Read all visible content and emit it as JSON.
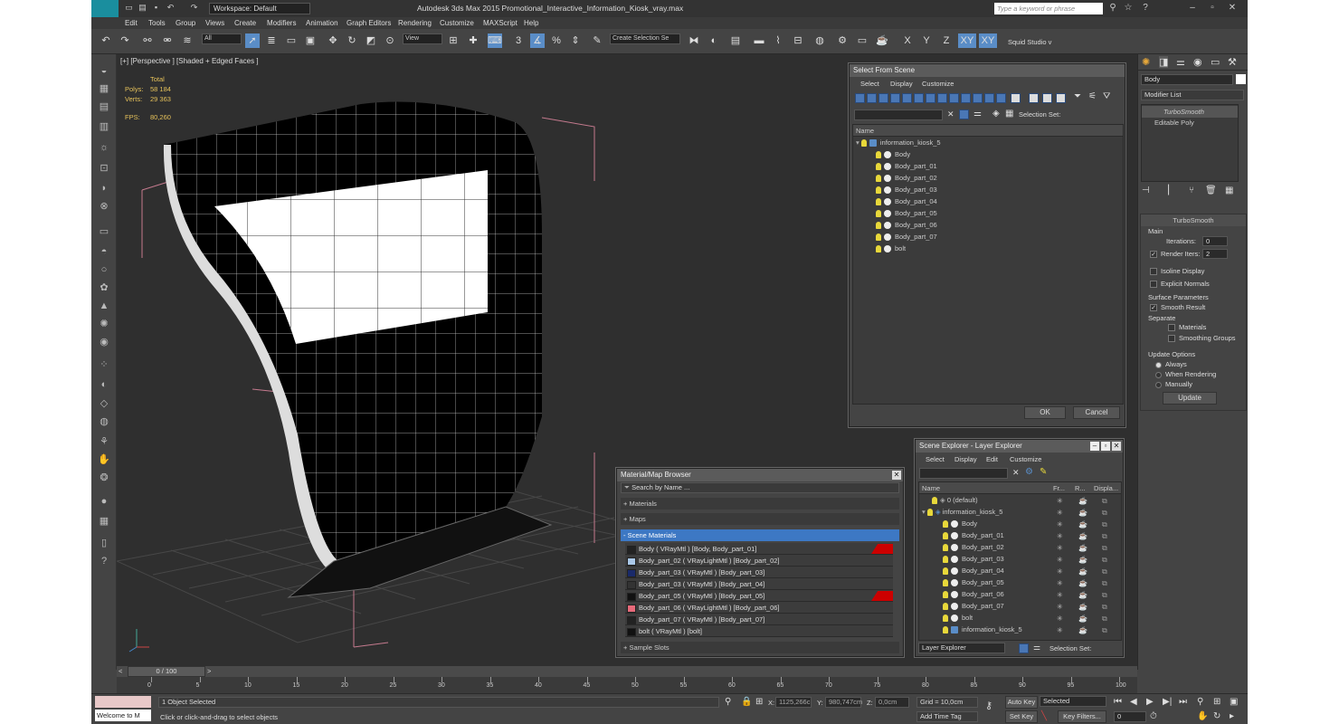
{
  "titlebar": {
    "workspace": "Workspace: Default",
    "title": "Autodesk 3ds Max 2015    Promotional_Interactive_Information_Kiosk_vray.max",
    "search_placeholder": "Type a keyword or phrase",
    "logo": "MAX"
  },
  "menu": [
    "Edit",
    "Tools",
    "Group",
    "Views",
    "Create",
    "Modifiers",
    "Animation",
    "Graph Editors",
    "Rendering",
    "Customize",
    "MAXScript",
    "Help"
  ],
  "toolbar": {
    "filter": "All",
    "ref": "View",
    "selset": "Create Selection Se",
    "axes": [
      "X",
      "Y",
      "Z",
      "XY",
      "XY"
    ],
    "studio": "Squid Studio v"
  },
  "viewport": {
    "label": "[+] [Perspective ] [Shaded + Edged Faces ]",
    "stats": {
      "total": "Total",
      "polys_label": "Polys:",
      "polys": "58 184",
      "verts_label": "Verts:",
      "verts": "29 363",
      "fps_label": "FPS:",
      "fps": "80,260"
    }
  },
  "select_scene": {
    "title": "Select From Scene",
    "menu": [
      "Select",
      "Display",
      "Customize"
    ],
    "selset_label": "Selection Set:",
    "col_name": "Name",
    "root": "information_kiosk_5",
    "items": [
      "Body",
      "Body_part_01",
      "Body_part_02",
      "Body_part_03",
      "Body_part_04",
      "Body_part_05",
      "Body_part_06",
      "Body_part_07",
      "bolt"
    ],
    "ok": "OK",
    "cancel": "Cancel"
  },
  "scene_explorer": {
    "title": "Scene Explorer - Layer Explorer",
    "menu": [
      "Select",
      "Display",
      "Edit",
      "Customize"
    ],
    "cols": [
      "Name",
      "Fr...",
      "R...",
      "Displa..."
    ],
    "default_layer": "0 (default)",
    "root": "information_kiosk_5",
    "items": [
      "Body",
      "Body_part_01",
      "Body_part_02",
      "Body_part_03",
      "Body_part_04",
      "Body_part_05",
      "Body_part_06",
      "Body_part_07",
      "bolt",
      "information_kiosk_5"
    ],
    "footer_left": "Layer Explorer",
    "footer_right": "Selection Set:"
  },
  "mat_browser": {
    "title": "Material/Map Browser",
    "search": "Search by Name ...",
    "groups": [
      "+ Materials",
      "+ Maps",
      "- Scene Materials"
    ],
    "materials": [
      "Body  ( VRayMtl )  [Body, Body_part_01]",
      "Body_part_02  ( VRayLightMtl )  [Body_part_02]",
      "Body_part_03  ( VRayMtl )  [Body_part_03]",
      "Body_part_03  ( VRayMtl )  [Body_part_04]",
      "Body_part_05  ( VRayMtl )  [Body_part_05]",
      "Body_part_06  ( VRayLightMtl )  [Body_part_06]",
      "Body_part_07  ( VRayMtl )  [Body_part_07]",
      "bolt  ( VRayMtl )  [bolt]"
    ],
    "swatches": [
      "#222",
      "#aac8e8",
      "#1a2a6a",
      "#333",
      "#111",
      "#e86a7a",
      "#222",
      "#111"
    ],
    "sample_slots": "+ Sample Slots"
  },
  "command_panel": {
    "obj_name": "Body",
    "modlist": "Modifier List",
    "stack": [
      "TurboSmooth",
      "Editable Poly"
    ],
    "rollout": "TurboSmooth",
    "main": "Main",
    "iterations_label": "Iterations:",
    "iterations": "0",
    "render_iters_label": "Render Iters:",
    "render_iters": "2",
    "isoline": "Isoline Display",
    "explicit": "Explicit Normals",
    "surface": "Surface Parameters",
    "smooth": "Smooth Result",
    "separate": "Separate",
    "materials": "Materials",
    "smoothing": "Smoothing Groups",
    "update_opts": "Update Options",
    "always": "Always",
    "when_rendering": "When Rendering",
    "manually": "Manually",
    "update": "Update"
  },
  "timeline": {
    "frame": "0 / 100",
    "ticks": [
      "0",
      "5",
      "10",
      "15",
      "20",
      "25",
      "30",
      "35",
      "40",
      "45",
      "50",
      "55",
      "60",
      "65",
      "70",
      "75",
      "80",
      "85",
      "90",
      "95",
      "100"
    ]
  },
  "status": {
    "welcome": "Welcome to M",
    "selected": "1 Object Selected",
    "prompt": "Click or click-and-drag to select objects",
    "x_label": "X:",
    "x": "1125,266c",
    "y_label": "Y:",
    "y": "980,747cm",
    "z_label": "Z:",
    "z": "0,0cm",
    "grid": "Grid = 10,0cm",
    "addtime": "Add Time Tag",
    "autokey": "Auto Key",
    "setkey": "Set Key",
    "selected_drop": "Selected",
    "keyfilters": "Key Filters...",
    "frame": "0"
  }
}
